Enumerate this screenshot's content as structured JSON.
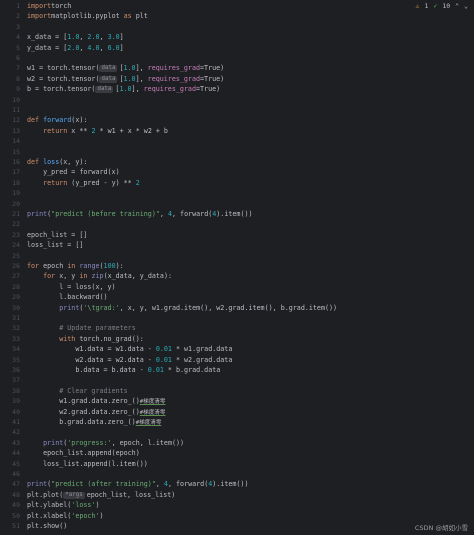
{
  "status": {
    "warnings": "1",
    "checks": "10",
    "warn_icon": "warning-triangle-icon",
    "check_icon": "checkmark-icon",
    "up_icon": "chevron-up-icon",
    "down_icon": "chevron-down-icon"
  },
  "hints": {
    "data": "data",
    "args": "*args"
  },
  "comments_cn": "#梯度清零",
  "watermark": "CSDN @胡如小雪",
  "line_numbers": [
    "1",
    "2",
    "3",
    "4",
    "5",
    "6",
    "7",
    "8",
    "9",
    "10",
    "11",
    "12",
    "13",
    "14",
    "15",
    "16",
    "17",
    "18",
    "19",
    "20",
    "21",
    "22",
    "23",
    "24",
    "25",
    "26",
    "27",
    "28",
    "29",
    "30",
    "31",
    "32",
    "33",
    "34",
    "35",
    "36",
    "37",
    "38",
    "39",
    "40",
    "41",
    "42",
    "43",
    "44",
    "45",
    "46",
    "47",
    "48",
    "49",
    "50",
    "51"
  ],
  "lines": [
    [
      [
        "kw",
        "import"
      ],
      [
        "",
        "torch"
      ]
    ],
    [
      [
        "kw",
        "import"
      ],
      [
        "",
        "matplotlib.pyplot "
      ],
      [
        "kw",
        "as"
      ],
      [
        "",
        " plt"
      ]
    ],
    [],
    [
      [
        "",
        "x_data = ["
      ],
      [
        "num",
        "1.0"
      ],
      [
        "",
        ", "
      ],
      [
        "num",
        "2.0"
      ],
      [
        "",
        ", "
      ],
      [
        "num",
        "3.0"
      ],
      [
        "",
        "]"
      ]
    ],
    [
      [
        "",
        "y_data = ["
      ],
      [
        "num",
        "2.0"
      ],
      [
        "",
        ", "
      ],
      [
        "num",
        "4.0"
      ],
      [
        "",
        ", "
      ],
      [
        "num",
        "6.0"
      ],
      [
        "",
        "]"
      ]
    ],
    [],
    [
      [
        "",
        "w1 = torch.tensor("
      ],
      [
        "hint",
        "data"
      ],
      [
        "",
        "["
      ],
      [
        "num",
        "1.0"
      ],
      [
        "",
        "], "
      ],
      [
        "param",
        "requires_grad"
      ],
      [
        "",
        "=True)"
      ]
    ],
    [
      [
        "",
        "w2 = torch.tensor("
      ],
      [
        "hint",
        "data"
      ],
      [
        "",
        "["
      ],
      [
        "num",
        "1.0"
      ],
      [
        "",
        "], "
      ],
      [
        "param",
        "requires_grad"
      ],
      [
        "",
        "=True)"
      ]
    ],
    [
      [
        "",
        "b = torch.tensor("
      ],
      [
        "hint",
        "data"
      ],
      [
        "",
        "["
      ],
      [
        "num",
        "1.0"
      ],
      [
        "",
        "], "
      ],
      [
        "param",
        "requires_grad"
      ],
      [
        "",
        "=True)"
      ]
    ],
    [],
    [],
    [
      [
        "kw",
        "def "
      ],
      [
        "fn",
        "forward"
      ],
      [
        "",
        "(x):"
      ]
    ],
    [
      [
        "",
        "    "
      ],
      [
        "kw",
        "return"
      ],
      [
        "",
        " x ** "
      ],
      [
        "num",
        "2"
      ],
      [
        "",
        " * w1 + x * w2 + b"
      ]
    ],
    [],
    [],
    [
      [
        "kw",
        "def "
      ],
      [
        "fn",
        "loss"
      ],
      [
        "",
        "(x, y):"
      ]
    ],
    [
      [
        "",
        "    y_pred = forward(x)"
      ]
    ],
    [
      [
        "",
        "    "
      ],
      [
        "kw",
        "return"
      ],
      [
        "",
        " (y_pred - y) ** "
      ],
      [
        "num",
        "2"
      ]
    ],
    [],
    [],
    [
      [
        "bi",
        "print"
      ],
      [
        "",
        "("
      ],
      [
        "str",
        "\"predict (before training)\""
      ],
      [
        "",
        ", "
      ],
      [
        "num",
        "4"
      ],
      [
        "",
        ", forward("
      ],
      [
        "num",
        "4"
      ],
      [
        "",
        ").item())"
      ]
    ],
    [],
    [
      [
        "",
        "epoch_list = []"
      ]
    ],
    [
      [
        "",
        "loss_list = []"
      ]
    ],
    [],
    [
      [
        "kw",
        "for"
      ],
      [
        "",
        " epoch "
      ],
      [
        "kw",
        "in"
      ],
      [
        "",
        " "
      ],
      [
        "bi",
        "range"
      ],
      [
        "",
        "("
      ],
      [
        "num",
        "100"
      ],
      [
        "",
        "):"
      ]
    ],
    [
      [
        "",
        "    "
      ],
      [
        "kw",
        "for"
      ],
      [
        "",
        " x, y "
      ],
      [
        "kw",
        "in"
      ],
      [
        "",
        " "
      ],
      [
        "bi",
        "zip"
      ],
      [
        "",
        "(x_data, y_data):"
      ]
    ],
    [
      [
        "",
        "        l = loss(x, y)"
      ]
    ],
    [
      [
        "",
        "        l.backward()"
      ]
    ],
    [
      [
        "",
        "        "
      ],
      [
        "bi",
        "print"
      ],
      [
        "",
        "("
      ],
      [
        "str",
        "'\\tgrad:'"
      ],
      [
        "",
        ", x, y, w1.grad.item(), w2.grad.item(), b.grad.item())"
      ]
    ],
    [],
    [
      [
        "",
        "        "
      ],
      [
        "cm",
        "# Update parameters"
      ]
    ],
    [
      [
        "",
        "        "
      ],
      [
        "kw",
        "with"
      ],
      [
        "",
        " torch.no_grad():"
      ]
    ],
    [
      [
        "",
        "            w1.data = w1.data - "
      ],
      [
        "num",
        "0.01"
      ],
      [
        "",
        " * w1.grad.data"
      ]
    ],
    [
      [
        "",
        "            w2.data = w2.data - "
      ],
      [
        "num",
        "0.01"
      ],
      [
        "",
        " * w2.grad.data"
      ]
    ],
    [
      [
        "",
        "            b.data = b.data - "
      ],
      [
        "num",
        "0.01"
      ],
      [
        "",
        " * b.grad.data"
      ]
    ],
    [],
    [
      [
        "",
        "        "
      ],
      [
        "cm",
        "# Clear gradients"
      ]
    ],
    [
      [
        "",
        "        w1.grad.data.zero_()"
      ],
      [
        "cn",
        "#梯度清零"
      ]
    ],
    [
      [
        "",
        "        w2.grad.data.zero_()"
      ],
      [
        "cn",
        "#梯度清零"
      ]
    ],
    [
      [
        "",
        "        b.grad.data.zero_()"
      ],
      [
        "cn",
        "#梯度清零"
      ]
    ],
    [],
    [
      [
        "",
        "    "
      ],
      [
        "bi",
        "print"
      ],
      [
        "",
        "("
      ],
      [
        "str",
        "'progress:'"
      ],
      [
        "",
        ", epoch, l.item())"
      ]
    ],
    [
      [
        "",
        "    epoch_list.append(epoch)"
      ]
    ],
    [
      [
        "",
        "    loss_list.append(l.item())"
      ]
    ],
    [],
    [
      [
        "bi",
        "print"
      ],
      [
        "",
        "("
      ],
      [
        "str",
        "\"predict (after training)\""
      ],
      [
        "",
        ", "
      ],
      [
        "num",
        "4"
      ],
      [
        "",
        ", forward("
      ],
      [
        "num",
        "4"
      ],
      [
        "",
        ").item())"
      ]
    ],
    [
      [
        "",
        "plt.plot("
      ],
      [
        "hint",
        "*args"
      ],
      [
        "",
        "epoch_list, loss_list)"
      ]
    ],
    [
      [
        "",
        "plt.ylabel("
      ],
      [
        "str",
        "'loss'"
      ],
      [
        "",
        ")"
      ]
    ],
    [
      [
        "",
        "plt.xlabel("
      ],
      [
        "str",
        "'epoch'"
      ],
      [
        "",
        ")"
      ]
    ],
    [
      [
        "",
        "plt.show()"
      ]
    ]
  ]
}
